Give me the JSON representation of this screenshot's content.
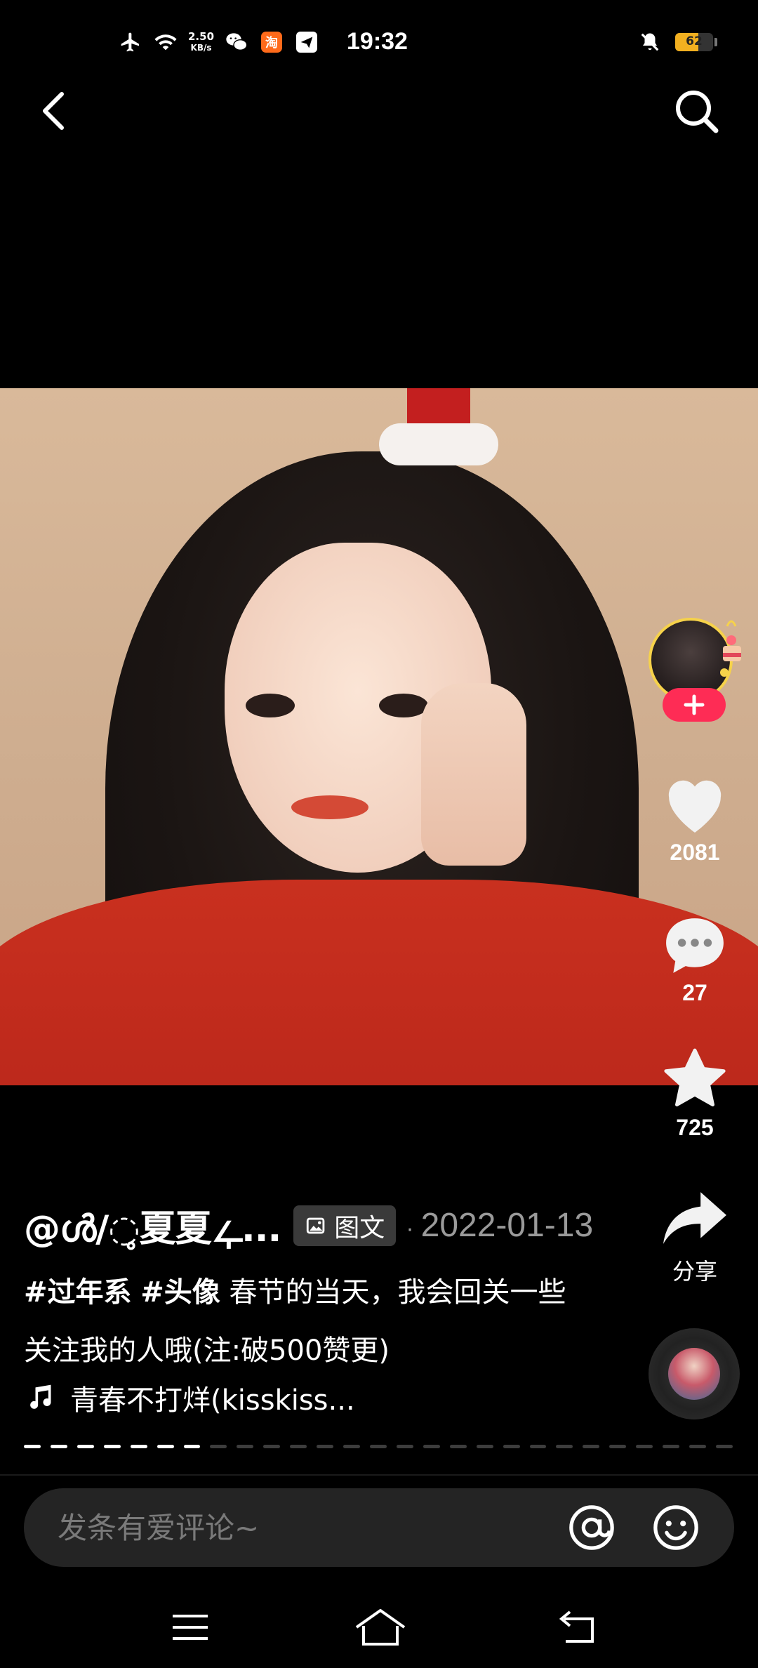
{
  "status_bar": {
    "time": "19:32",
    "net_speed_value": "2.50",
    "net_speed_unit": "KB/s",
    "battery": "62",
    "icons": [
      "airplane-icon",
      "wifi-icon",
      "wechat-icon",
      "taobao-icon",
      "telegram-icon",
      "mute-bell-icon",
      "battery-icon"
    ]
  },
  "post": {
    "author": "@ൾ/◌̥夏夏ഺ...",
    "type_badge": "图文",
    "date": "2022-01-13",
    "date_separator": "·",
    "hashtags": [
      "#过年系",
      "#头像"
    ],
    "caption_text": "春节的当天，我会回关一些关注我的人哦(注:破500赞更)",
    "music": "青春不打烊(kisskiss..."
  },
  "actions": {
    "likes": "2081",
    "comments": "27",
    "favorites": "725",
    "share_label": "分享"
  },
  "progress": {
    "total": 27,
    "current": 7
  },
  "comment_bar": {
    "placeholder": "发条有爱评论~"
  },
  "colors": {
    "follow": "#fe2c55",
    "battery": "#f2b020"
  }
}
